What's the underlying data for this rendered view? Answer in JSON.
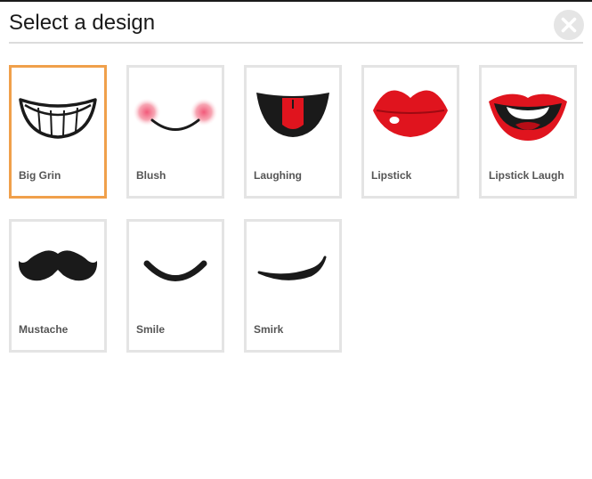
{
  "dialog": {
    "title": "Select a design",
    "close_icon": "close-icon"
  },
  "designs": [
    {
      "label": "Big Grin",
      "icon": "big-grin-icon",
      "selected": true
    },
    {
      "label": "Blush",
      "icon": "blush-icon",
      "selected": false
    },
    {
      "label": "Laughing",
      "icon": "laughing-icon",
      "selected": false
    },
    {
      "label": "Lipstick",
      "icon": "lipstick-icon",
      "selected": false
    },
    {
      "label": "Lipstick Laugh",
      "icon": "lipstick-laugh-icon",
      "selected": false
    },
    {
      "label": "Mustache",
      "icon": "mustache-icon",
      "selected": false
    },
    {
      "label": "Smile",
      "icon": "smile-icon",
      "selected": false
    },
    {
      "label": "Smirk",
      "icon": "smirk-icon",
      "selected": false
    }
  ],
  "colors": {
    "selected_border": "#f0a04b",
    "tile_border": "#e4e4e4",
    "lip_red": "#e0141e",
    "ink": "#1a1a1a",
    "blush_pink": "#f7a7b4"
  }
}
